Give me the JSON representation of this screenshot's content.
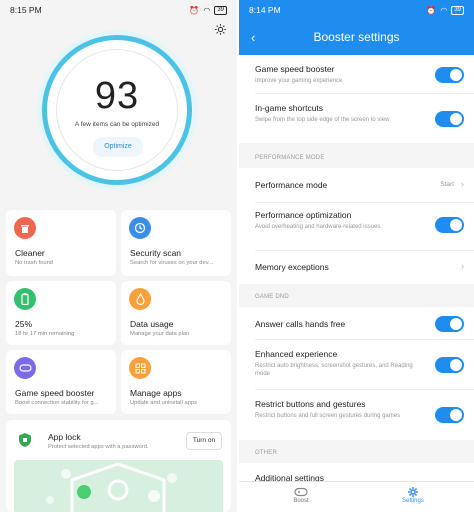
{
  "left": {
    "status": {
      "time": "8:15 PM",
      "battery": "39"
    },
    "score": {
      "value": "93",
      "subtitle": "A few items can be optimized",
      "button": "Optimize"
    },
    "cards": [
      {
        "title": "Cleaner",
        "sub": "No trash found",
        "icon": "trash-icon",
        "color": "#f0674f"
      },
      {
        "title": "Security scan",
        "sub": "Search for viruses on your dev...",
        "icon": "timer-icon",
        "color": "#3a8ee6"
      },
      {
        "title": "25%",
        "sub": "18 hr 17 min  remaining",
        "icon": "battery-icon",
        "color": "#35c06f"
      },
      {
        "title": "Data usage",
        "sub": "Manage your data plan",
        "icon": "water-drop-icon",
        "color": "#f8a13c"
      },
      {
        "title": "Game speed booster",
        "sub": "Boost connection stability for g...",
        "icon": "gamepad-icon",
        "color": "#7a6be8"
      },
      {
        "title": "Manage apps",
        "sub": "Update and uninstall apps",
        "icon": "apps-grid-icon",
        "color": "#f8a13c"
      }
    ],
    "applock": {
      "title": "App lock",
      "sub": "Protect selected apps with a password.",
      "button": "Turn on"
    }
  },
  "right": {
    "status": {
      "time": "8:14 PM",
      "battery": "39"
    },
    "title": "Booster settings",
    "rows": {
      "game_speed": {
        "title": "Game speed booster",
        "sub": "Improve your gaming experience",
        "on": true
      },
      "ingame": {
        "title": "In-game shortcuts",
        "sub": "Swipe from the top side edge of the screen to view",
        "on": true
      },
      "perf_mode": {
        "title": "Performance mode",
        "value": "Start"
      },
      "perf_opt": {
        "title": "Performance optimization",
        "sub": "Avoid overheating and hardware-related issues",
        "on": true
      },
      "mem": {
        "title": "Memory exceptions"
      },
      "answer": {
        "title": "Answer calls hands free",
        "on": true
      },
      "enhanced": {
        "title": "Enhanced experience",
        "sub": "Restrict auto brightness, screenshot gestures, and Reading mode",
        "on": true
      },
      "restrict": {
        "title": "Restrict buttons and gestures",
        "sub": "Restrict buttons and full screen gestures during games",
        "on": true
      },
      "additional": {
        "title": "Additional settings"
      }
    },
    "sections": {
      "performance": "PERFORMANCE MODE",
      "dnd": "GAME DND",
      "other": "OTHER"
    },
    "nav": {
      "boost": "Boost",
      "settings": "Settings"
    },
    "accent": "#1f8cf0"
  }
}
